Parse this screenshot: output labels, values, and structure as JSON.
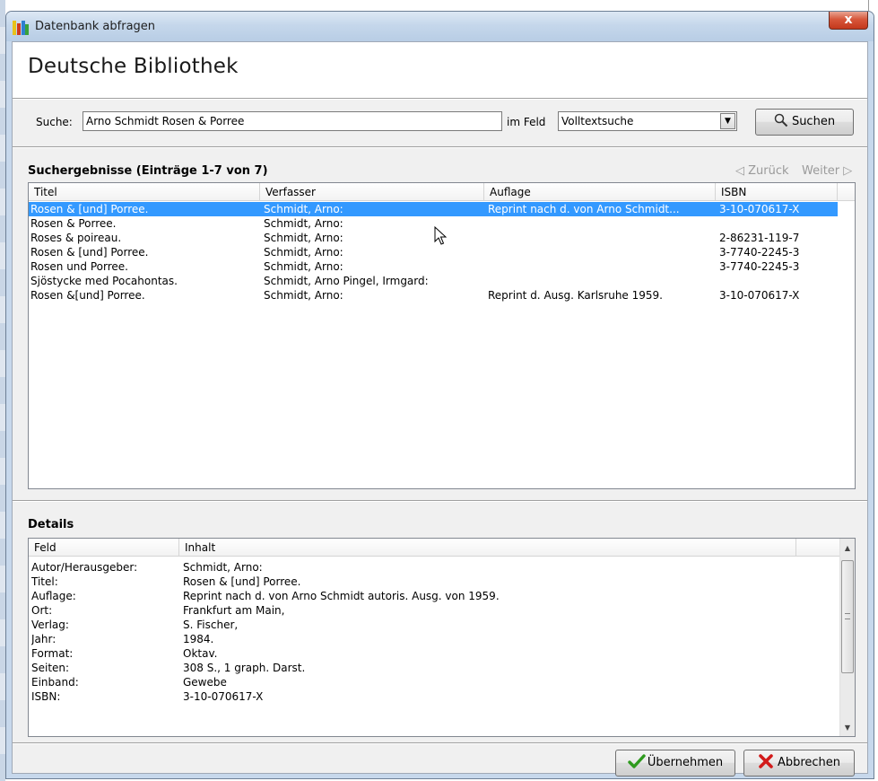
{
  "window": {
    "title": "Datenbank abfragen",
    "close_label": "x"
  },
  "header": {
    "title": "Deutsche Bibliothek"
  },
  "search": {
    "label": "Suche:",
    "value": "Arno Schmidt Rosen & Porree",
    "field_label": "im Feld",
    "field_value": "Volltextsuche",
    "button_label": "Suchen"
  },
  "results": {
    "title": "Suchergebnisse (Einträge 1-7 von 7)",
    "prev_label": "Zurück",
    "next_label": "Weiter",
    "columns": [
      "Titel",
      "Verfasser",
      "Auflage",
      "ISBN"
    ],
    "rows": [
      [
        "Rosen & [und] Porree.",
        "Schmidt, Arno:",
        "Reprint nach d. von Arno Schmidt...",
        "3-10-070617-X"
      ],
      [
        "Rosen & Porree.",
        "Schmidt, Arno:",
        "",
        ""
      ],
      [
        "Roses & poireau.",
        "Schmidt, Arno:",
        "",
        "2-86231-119-7"
      ],
      [
        "Rosen & [und] Porree.",
        "Schmidt, Arno:",
        "",
        "3-7740-2245-3"
      ],
      [
        "Rosen und Porree.",
        "Schmidt, Arno:",
        "",
        "3-7740-2245-3"
      ],
      [
        "Sjöstycke med Pocahontas.",
        "Schmidt, Arno Pingel, Irmgard:",
        "",
        ""
      ],
      [
        "Rosen &[und] Porree.",
        "Schmidt, Arno:",
        "Reprint d. Ausg. Karlsruhe 1959.",
        "3-10-070617-X"
      ]
    ],
    "selected_index": 0
  },
  "details": {
    "title": "Details",
    "columns": [
      "Feld",
      "Inhalt"
    ],
    "rows": [
      [
        "Autor/Herausgeber:",
        "Schmidt, Arno:"
      ],
      [
        "Titel:",
        "Rosen & [und] Porree."
      ],
      [
        "Auflage:",
        "Reprint nach d. von Arno Schmidt autoris. Ausg. von 1959."
      ],
      [
        "Ort:",
        "Frankfurt am Main,"
      ],
      [
        "Verlag:",
        "S. Fischer,"
      ],
      [
        "Jahr:",
        "1984."
      ],
      [
        "Format:",
        "Oktav."
      ],
      [
        "Seiten:",
        "308 S., 1 graph. Darst."
      ],
      [
        "Einband:",
        "Gewebe"
      ],
      [
        "ISBN:",
        "3-10-070617-X"
      ]
    ]
  },
  "footer": {
    "accept_label": "Übernehmen",
    "cancel_label": "Abbrechen"
  },
  "icons": {
    "app": "books-icon",
    "search": "magnifier-icon",
    "prev": "triangle-left-icon",
    "next": "triangle-right-icon",
    "accept": "checkmark-icon",
    "cancel": "red-x-icon"
  },
  "colors": {
    "selection": "#3399ff",
    "accept_icon": "#2e9a1e",
    "cancel_icon": "#d21a1a"
  }
}
